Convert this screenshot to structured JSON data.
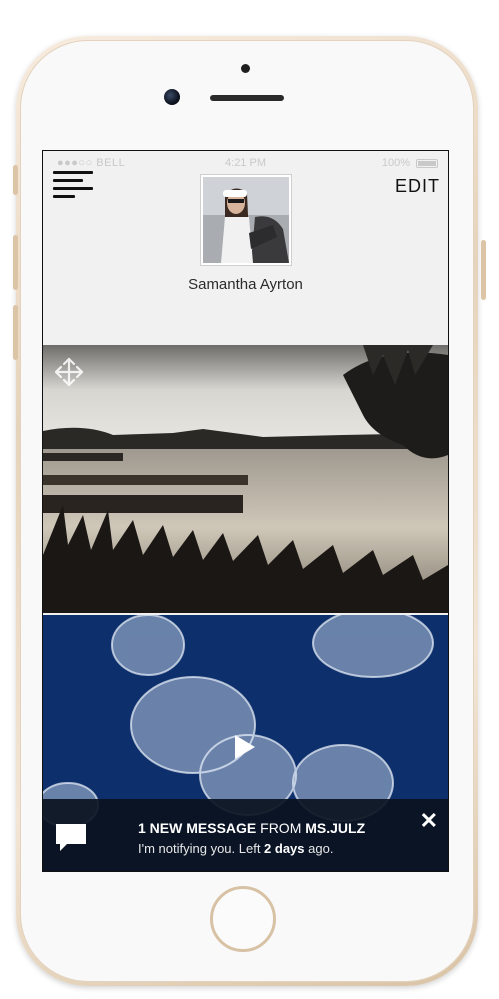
{
  "status_bar": {
    "carrier": "●●●○○ BELL",
    "time": "4:21 PM",
    "battery": "100%"
  },
  "header": {
    "menu_icon": "hamburger-menu-icon",
    "edit_label": "EDIT"
  },
  "profile": {
    "name": "Samantha Ayrton"
  },
  "feed": {
    "photo_icon": "move-arrows-icon",
    "video_icon": "play-icon"
  },
  "notification": {
    "icon": "chat-bubble-icon",
    "title_bold": "1 NEW MESSAGE",
    "title_from": " FROM ",
    "title_sender": "MS.JULZ",
    "body_prefix": "I'm notifying you. Left ",
    "body_bold": "2 days",
    "body_suffix": " ago.",
    "close_icon": "close-icon"
  },
  "colors": {
    "notification_bg": "#0a1220",
    "video_bg": "#0d2f6b",
    "screen_bg": "#f1f1f1"
  }
}
